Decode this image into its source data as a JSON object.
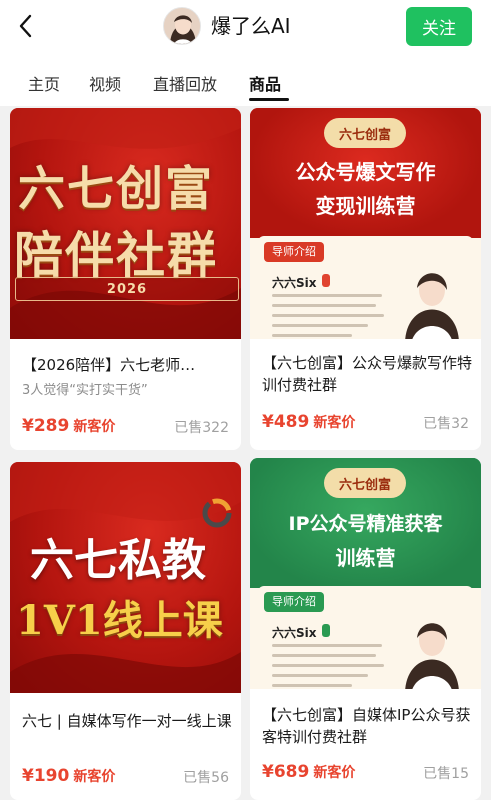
{
  "header": {
    "back_icon": "chevron-left-icon",
    "channel_name": "爆了么AI",
    "follow_label": "关注"
  },
  "tabs": [
    {
      "label": "主页",
      "active": false
    },
    {
      "label": "视频",
      "active": false
    },
    {
      "label": "直播回放",
      "active": false
    },
    {
      "label": "商品",
      "active": true
    }
  ],
  "colors": {
    "follow_green": "#1fc160",
    "price_red": "#e8442f",
    "poster_red": "#b4150f",
    "poster_green": "#2a9a52"
  },
  "products": [
    {
      "poster": {
        "line1": "六七创富",
        "line2": "陪伴社群",
        "year": "2026"
      },
      "title": "【2026陪伴】六七老师…",
      "subtitle": "3人觉得“实打实干货”",
      "price": "¥289",
      "price_tag": "新客价",
      "sold": "已售322"
    },
    {
      "poster": {
        "brand": "六七创富",
        "headline_1": "公众号爆文写作",
        "headline_2": "变现训练营",
        "mentor_tag": "导师介绍",
        "mentor_name": "六六Six"
      },
      "title": "【六七创富】公众号爆款写作特训付费社群",
      "price": "¥489",
      "price_tag": "新客价",
      "sold": "已售32"
    },
    {
      "poster": {
        "line1": "六七私教",
        "line2": "1V1线上课"
      },
      "title": "六七 | 自媒体写作一对一线上课",
      "price": "¥190",
      "price_tag": "新客价",
      "sold": "已售56"
    },
    {
      "poster": {
        "brand": "六七创富",
        "headline_1": "IP公众号精准获客",
        "headline_2": "训练营",
        "mentor_tag": "导师介绍",
        "mentor_name": "六六Six"
      },
      "title": "【六七创富】自媒体IP公众号获客特训付费社群",
      "price": "¥689",
      "price_tag": "新客价",
      "sold": "已售15"
    }
  ]
}
